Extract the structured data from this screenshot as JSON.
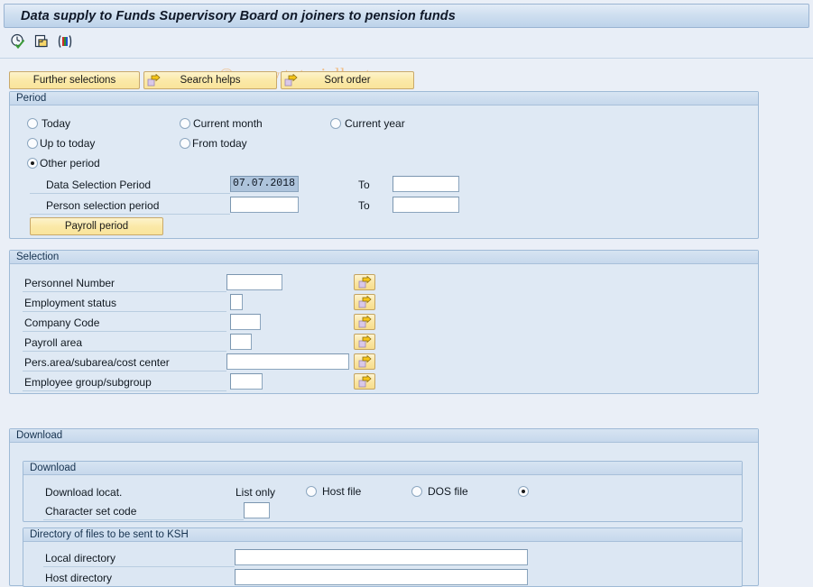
{
  "window": {
    "title": "Data supply to Funds Supervisory Board on joiners to pension funds"
  },
  "watermark": {
    "text": "© www.tutorialkart.com"
  },
  "toolbar": {
    "icons": [
      {
        "name": "execute-clock-check-icon",
        "title": "Execute"
      },
      {
        "name": "copy-document-icon",
        "title": "Copy"
      },
      {
        "name": "color-bars-icon",
        "title": "Layout"
      }
    ]
  },
  "button_row": [
    {
      "name": "further-selections-button",
      "label": "Further selections",
      "has_arrow": false
    },
    {
      "name": "search-helps-button",
      "label": "Search helps",
      "has_arrow": true
    },
    {
      "name": "sort-order-button",
      "label": "Sort order",
      "has_arrow": true
    }
  ],
  "period": {
    "header": "Period",
    "radios": [
      {
        "name": "radio-today",
        "label": "Today",
        "selected": false
      },
      {
        "name": "radio-current-month",
        "label": "Current month",
        "selected": false
      },
      {
        "name": "radio-current-year",
        "label": "Current year",
        "selected": false
      },
      {
        "name": "radio-up-to-today",
        "label": "Up to today",
        "selected": false
      },
      {
        "name": "radio-from-today",
        "label": "From today",
        "selected": false
      },
      {
        "name": "radio-other-period",
        "label": "Other period",
        "selected": true
      }
    ],
    "rows": [
      {
        "label": "Data Selection Period",
        "value": "07.07.2018",
        "value_selected": true,
        "to_label": "To",
        "to_value": ""
      },
      {
        "label": "Person selection period",
        "value": "",
        "value_selected": false,
        "to_label": "To",
        "to_value": ""
      }
    ],
    "payroll_period_button": "Payroll period"
  },
  "selection": {
    "header": "Selection",
    "rows": [
      {
        "label": "Personnel Number",
        "value": "",
        "field_width": 62,
        "arrow": "multi-select-arrow"
      },
      {
        "label": "Employment status",
        "value": "",
        "field_width": 14,
        "arrow": "multi-select-arrow"
      },
      {
        "label": "Company Code",
        "value": "",
        "field_width": 31,
        "arrow": "multi-select-arrow"
      },
      {
        "label": "Payroll area",
        "value": "",
        "field_width": 22,
        "arrow": "multi-select-arrow"
      },
      {
        "label": "Pers.area/subarea/cost center",
        "value": "",
        "field_width": 120,
        "arrow": "multi-select-arrow"
      },
      {
        "label": "Employee group/subgroup",
        "value": "",
        "field_width": 32,
        "arrow": "multi-select-arrow"
      }
    ]
  },
  "download": {
    "header": "Download",
    "inner_header": "Download",
    "locat_label": "Download locat.",
    "list_only_label": "List only",
    "options": [
      {
        "name": "radio-host-file",
        "label": "Host file",
        "selected": false
      },
      {
        "name": "radio-dos-file",
        "label": "DOS file",
        "selected": false
      },
      {
        "name": "radio-list-only-selected",
        "label": "",
        "selected": true
      }
    ],
    "charset_label": "Character set code",
    "charset_value": "",
    "directory": {
      "header": "Directory of files to be sent to KSH",
      "rows": [
        {
          "label": "Local directory",
          "value": ""
        },
        {
          "label": "Host directory",
          "value": ""
        }
      ]
    }
  },
  "colors": {
    "page_background": "#eaeff7",
    "panel_background": "#dfe9f4",
    "panel_header": "#c6d8ec",
    "title_bar": "#bdd3ea",
    "button_yellow": "#fbe9a8",
    "watermark": "#f0c08c",
    "field_selected": "#aec4dc",
    "border": "#9fbad6"
  }
}
